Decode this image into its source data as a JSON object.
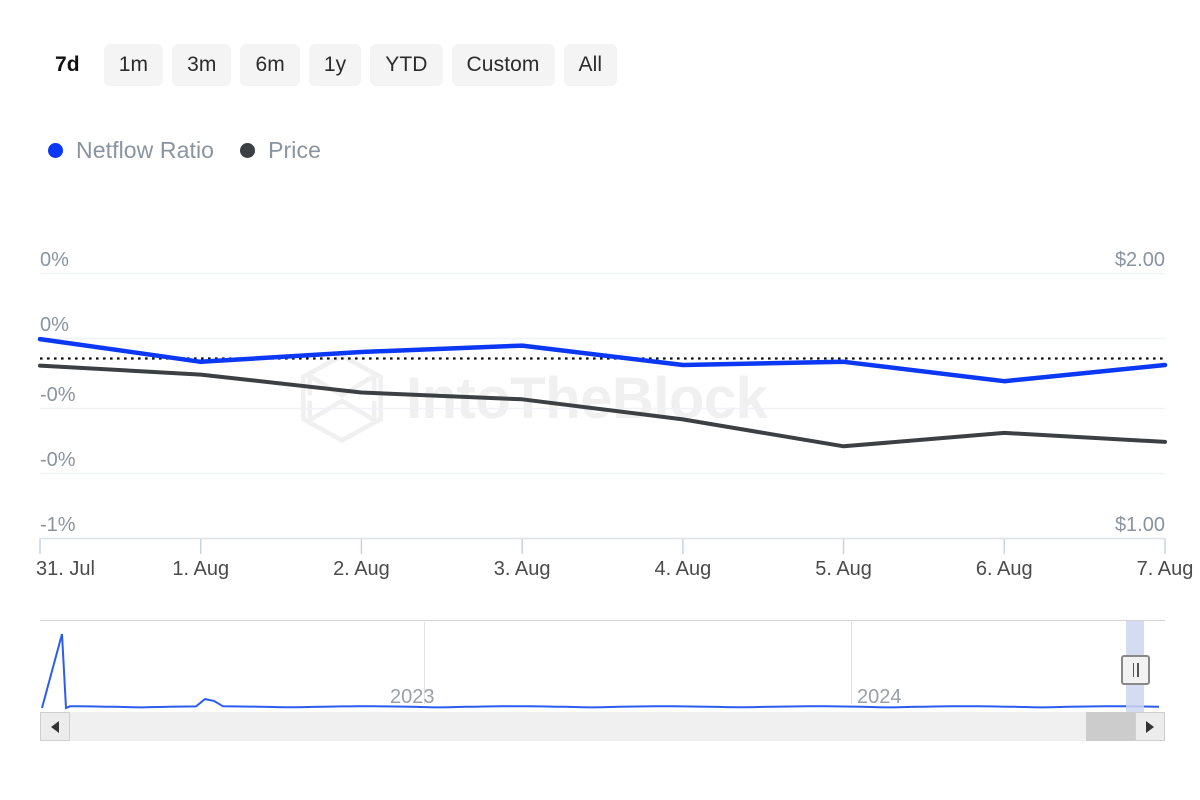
{
  "range_selector": {
    "options": [
      {
        "label": "7d",
        "active": true
      },
      {
        "label": "1m",
        "active": false
      },
      {
        "label": "3m",
        "active": false
      },
      {
        "label": "6m",
        "active": false
      },
      {
        "label": "1y",
        "active": false
      },
      {
        "label": "YTD",
        "active": false
      },
      {
        "label": "Custom",
        "active": false
      },
      {
        "label": "All",
        "active": false
      }
    ]
  },
  "legend": {
    "items": [
      {
        "label": "Netflow Ratio",
        "color": "#0b38f5"
      },
      {
        "label": "Price",
        "color": "#3c4043"
      }
    ]
  },
  "watermark": {
    "text": "IntoTheBlock",
    "logo_icon": "hexagon-cube-logo"
  },
  "navigator": {
    "year_labels": [
      "2023",
      "2024"
    ],
    "left_arrow_icon": "chevron-left-icon",
    "right_arrow_icon": "chevron-right-icon",
    "handle_icon": "resize-grabber-icon"
  },
  "chart_data": {
    "type": "line",
    "title": "",
    "xlabel": "",
    "grid": true,
    "legend_position": "top-left",
    "x": [
      "31. Jul",
      "1. Aug",
      "2. Aug",
      "3. Aug",
      "4. Aug",
      "5. Aug",
      "6. Aug",
      "7. Aug"
    ],
    "xtick_labels": [
      "31. Jul",
      "1. Aug",
      "2. Aug",
      "3. Aug",
      "4. Aug",
      "5. Aug",
      "6. Aug",
      "7. Aug"
    ],
    "axes": [
      {
        "id": "left",
        "name": "Netflow Ratio",
        "side": "left",
        "tick_labels": [
          "0%",
          "0%",
          "-0%",
          "-0%",
          "-1%"
        ],
        "tick_values": [
          0.5,
          0.1,
          -0.2,
          -0.5,
          -1.0
        ],
        "ylim": [
          -1.15,
          0.62
        ],
        "zero_line": 0
      },
      {
        "id": "right",
        "name": "Price",
        "side": "right",
        "tick_labels": [
          "$2.00",
          "$1.00"
        ],
        "tick_values": [
          2.0,
          1.0
        ],
        "ylim": [
          0.82,
          2.1
        ]
      }
    ],
    "series": [
      {
        "name": "Netflow Ratio",
        "axis": "left",
        "color": "#0b38f5",
        "values": [
          0.12,
          -0.02,
          0.04,
          0.08,
          -0.04,
          -0.02,
          -0.14,
          -0.04
        ]
      },
      {
        "name": "Price",
        "axis": "right",
        "color": "#3c4043",
        "values": [
          1.62,
          1.58,
          1.5,
          1.47,
          1.38,
          1.26,
          1.32,
          1.28
        ]
      }
    ]
  }
}
